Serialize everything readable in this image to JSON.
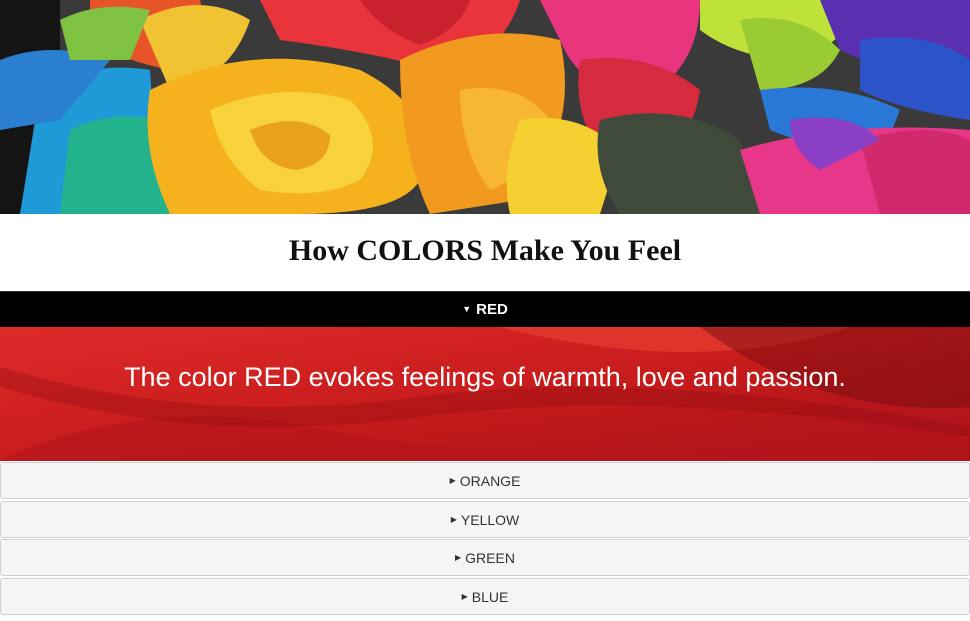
{
  "hero": {
    "image_alt_icon": "rainbow-rose-image"
  },
  "page": {
    "title": "How COLORS Make You Feel"
  },
  "accordion": {
    "active": {
      "label": "RED",
      "caret": "▼",
      "content": "The color RED evokes feelings of warmth, love and passion.",
      "color": "#d42323"
    },
    "items": [
      {
        "label": "ORANGE",
        "caret": "▶"
      },
      {
        "label": "YELLOW",
        "caret": "▶"
      },
      {
        "label": "GREEN",
        "caret": "▶"
      },
      {
        "label": "BLUE",
        "caret": "▶"
      }
    ]
  }
}
